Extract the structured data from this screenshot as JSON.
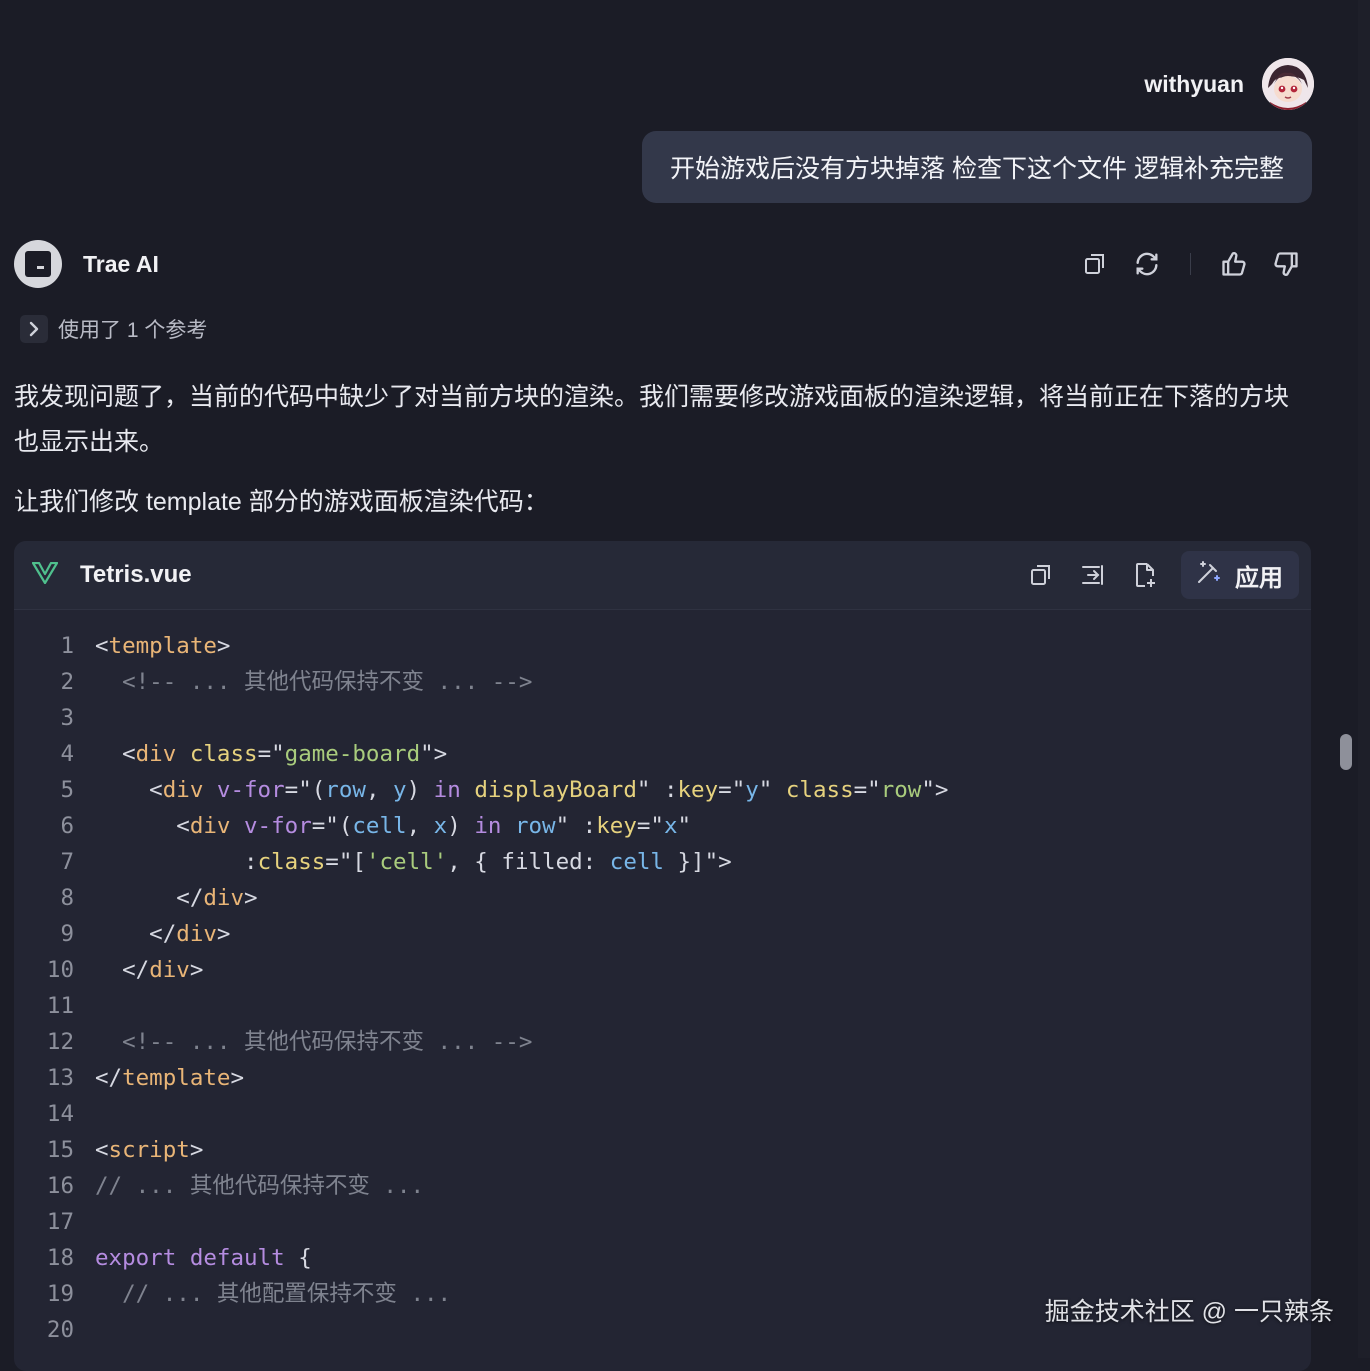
{
  "user": {
    "name": "withyuan",
    "message": "开始游戏后没有方块掉落 检查下这个文件 逻辑补充完整"
  },
  "assistant": {
    "name": "Trae AI",
    "references_label": "使用了 1 个参考",
    "paragraph1": "我发现问题了，当前的代码中缺少了对当前方块的渲染。我们需要修改游戏面板的渲染逻辑，将当前正在下落的方块也显示出来。",
    "paragraph2": "让我们修改 template 部分的游戏面板渲染代码："
  },
  "actions": [
    "copy-icon",
    "regenerate-icon",
    "thumbs-up-icon",
    "thumbs-down-icon"
  ],
  "code_block": {
    "filename": "Tetris.vue",
    "apply_label": "应用",
    "lines": [
      {
        "n": "1",
        "tokens": [
          [
            "p",
            "<"
          ],
          [
            "tag",
            "template"
          ],
          [
            "p",
            ">"
          ]
        ]
      },
      {
        "n": "2",
        "tokens": [
          [
            "cm",
            "  <!-- ... 其他代码保持不变 ... -->"
          ]
        ]
      },
      {
        "n": "3",
        "tokens": [
          [
            "p",
            " "
          ]
        ]
      },
      {
        "n": "4",
        "tokens": [
          [
            "p",
            "  <"
          ],
          [
            "tag",
            "div"
          ],
          [
            "p",
            " "
          ],
          [
            "attr",
            "class"
          ],
          [
            "p",
            "=\""
          ],
          [
            "str",
            "game-board"
          ],
          [
            "p",
            "\">"
          ]
        ]
      },
      {
        "n": "5",
        "tokens": [
          [
            "p",
            "    <"
          ],
          [
            "tag",
            "div"
          ],
          [
            "p",
            " "
          ],
          [
            "kw",
            "v-for"
          ],
          [
            "p",
            "=\"("
          ],
          [
            "var",
            "row"
          ],
          [
            "p",
            ", "
          ],
          [
            "var",
            "y"
          ],
          [
            "p",
            ") "
          ],
          [
            "kw",
            "in"
          ],
          [
            "p",
            " "
          ],
          [
            "attr",
            "displayBoard"
          ],
          [
            "p",
            "\" :"
          ],
          [
            "attr",
            "key"
          ],
          [
            "p",
            "=\""
          ],
          [
            "var",
            "y"
          ],
          [
            "p",
            "\" "
          ],
          [
            "attr",
            "class"
          ],
          [
            "p",
            "=\""
          ],
          [
            "str",
            "row"
          ],
          [
            "p",
            "\">"
          ]
        ]
      },
      {
        "n": "6",
        "tokens": [
          [
            "p",
            "      <"
          ],
          [
            "tag",
            "div"
          ],
          [
            "p",
            " "
          ],
          [
            "kw",
            "v-for"
          ],
          [
            "p",
            "=\"("
          ],
          [
            "var",
            "cell"
          ],
          [
            "p",
            ", "
          ],
          [
            "var",
            "x"
          ],
          [
            "p",
            ") "
          ],
          [
            "kw",
            "in"
          ],
          [
            "p",
            " "
          ],
          [
            "var",
            "row"
          ],
          [
            "p",
            "\" :"
          ],
          [
            "attr",
            "key"
          ],
          [
            "p",
            "=\""
          ],
          [
            "var",
            "x"
          ],
          [
            "p",
            "\""
          ]
        ]
      },
      {
        "n": "7",
        "tokens": [
          [
            "p",
            "           :"
          ],
          [
            "attr",
            "class"
          ],
          [
            "p",
            "=\"["
          ],
          [
            "str",
            "'cell'"
          ],
          [
            "p",
            ", { filled: "
          ],
          [
            "var",
            "cell"
          ],
          [
            "p",
            " }]\">"
          ]
        ]
      },
      {
        "n": "8",
        "tokens": [
          [
            "p",
            "      </"
          ],
          [
            "tag",
            "div"
          ],
          [
            "p",
            ">"
          ]
        ]
      },
      {
        "n": "9",
        "tokens": [
          [
            "p",
            "    </"
          ],
          [
            "tag",
            "div"
          ],
          [
            "p",
            ">"
          ]
        ]
      },
      {
        "n": "10",
        "tokens": [
          [
            "p",
            "  </"
          ],
          [
            "tag",
            "div"
          ],
          [
            "p",
            ">"
          ]
        ]
      },
      {
        "n": "11",
        "tokens": [
          [
            "p",
            " "
          ]
        ]
      },
      {
        "n": "12",
        "tokens": [
          [
            "cm",
            "  <!-- ... 其他代码保持不变 ... -->"
          ]
        ]
      },
      {
        "n": "13",
        "tokens": [
          [
            "p",
            "</"
          ],
          [
            "tag",
            "template"
          ],
          [
            "p",
            ">"
          ]
        ]
      },
      {
        "n": "14",
        "tokens": [
          [
            "p",
            " "
          ]
        ]
      },
      {
        "n": "15",
        "tokens": [
          [
            "p",
            "<"
          ],
          [
            "tag",
            "script"
          ],
          [
            "p",
            ">"
          ]
        ]
      },
      {
        "n": "16",
        "tokens": [
          [
            "cm",
            "// ... 其他代码保持不变 ..."
          ]
        ]
      },
      {
        "n": "17",
        "tokens": [
          [
            "p",
            " "
          ]
        ]
      },
      {
        "n": "18",
        "tokens": [
          [
            "kw",
            "export"
          ],
          [
            "p",
            " "
          ],
          [
            "kw",
            "default"
          ],
          [
            "p",
            " {"
          ]
        ]
      },
      {
        "n": "19",
        "tokens": [
          [
            "cm",
            "  // ... 其他配置保持不变 ..."
          ]
        ]
      },
      {
        "n": "20",
        "tokens": [
          [
            "p",
            " "
          ]
        ]
      }
    ]
  },
  "watermark": "掘金技术社区 @ 一只辣条"
}
